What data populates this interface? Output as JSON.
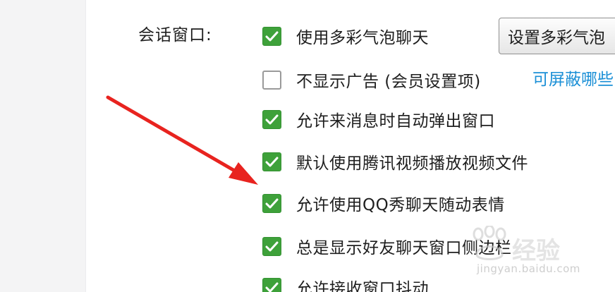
{
  "session": {
    "label": "会话窗口:",
    "set_bubble_button": "设置多彩气泡",
    "options": [
      {
        "label": "使用多彩气泡聊天",
        "checked": true
      },
      {
        "label": "不显示广告 (会员设置项)",
        "checked": false
      },
      {
        "label": "允许来消息时自动弹出窗口",
        "checked": true
      },
      {
        "label": "默认使用腾讯视频播放视频文件",
        "checked": true
      },
      {
        "label": "允许使用QQ秀聊天随动表情",
        "checked": true
      },
      {
        "label": "总是显示好友聊天窗口侧边栏",
        "checked": true
      },
      {
        "label": "允许接收窗口抖动",
        "checked": true
      }
    ],
    "ad_link": "可屏蔽哪些"
  },
  "colors": {
    "check_green": "#3ea13a",
    "link_blue": "#1a8fd6",
    "arrow_red": "#e8231f"
  },
  "watermark": {
    "text": "经验",
    "sub": "jingyan.baidu.com"
  }
}
